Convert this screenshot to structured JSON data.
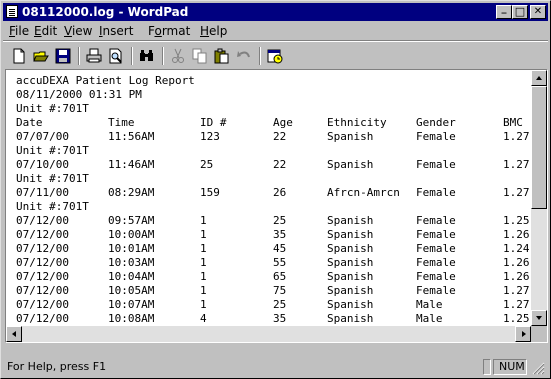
{
  "window": {
    "title": "08112000.log - WordPad",
    "minimize_glyph": "_",
    "maximize_glyph": "□",
    "close_glyph": "✕"
  },
  "menu": [
    {
      "accel": "F",
      "rest": "ile"
    },
    {
      "accel": "E",
      "rest": "dit"
    },
    {
      "accel": "V",
      "rest": "iew"
    },
    {
      "accel": "I",
      "rest": "nsert"
    },
    {
      "pre": "F",
      "accel": "o",
      "rest": "rmat"
    },
    {
      "accel": "H",
      "rest": "elp"
    }
  ],
  "toolbar": {
    "buttons": [
      "new-icon",
      "open-icon",
      "save-icon",
      "print-icon",
      "print-preview-icon",
      "find-icon",
      "cut-icon",
      "copy-icon",
      "paste-icon",
      "undo-icon",
      "date-time-icon"
    ],
    "disabled": [
      "cut-icon",
      "copy-icon",
      "undo-icon"
    ]
  },
  "document": {
    "header_lines": [
      "accuDEXA Patient Log Report",
      "08/11/2000 01:31 PM",
      "Unit #:701T"
    ],
    "columns": [
      "Date",
      "Time",
      "ID #",
      "Age",
      "Ethnicity",
      "Gender",
      "BMC"
    ],
    "rows": [
      {
        "type": "data",
        "cells": [
          "07/07/00",
          "11:56AM",
          "123",
          "22",
          "Spanish",
          "Female",
          "1.27"
        ]
      },
      {
        "type": "unit",
        "text": "Unit #:701T"
      },
      {
        "type": "data",
        "cells": [
          "07/10/00",
          "11:46AM",
          "25",
          "22",
          "Spanish",
          "Female",
          "1.27"
        ]
      },
      {
        "type": "unit",
        "text": "Unit #:701T"
      },
      {
        "type": "data",
        "cells": [
          "07/11/00",
          "08:29AM",
          "159",
          "26",
          "Afrcn-Amrcn",
          "Female",
          "1.27"
        ]
      },
      {
        "type": "unit",
        "text": "Unit #:701T"
      },
      {
        "type": "data",
        "cells": [
          "07/12/00",
          "09:57AM",
          "1",
          "25",
          "Spanish",
          "Female",
          "1.25"
        ]
      },
      {
        "type": "data",
        "cells": [
          "07/12/00",
          "10:00AM",
          "1",
          "35",
          "Spanish",
          "Female",
          "1.26"
        ]
      },
      {
        "type": "data",
        "cells": [
          "07/12/00",
          "10:01AM",
          "1",
          "45",
          "Spanish",
          "Female",
          "1.24"
        ]
      },
      {
        "type": "data",
        "cells": [
          "07/12/00",
          "10:03AM",
          "1",
          "55",
          "Spanish",
          "Female",
          "1.26"
        ]
      },
      {
        "type": "data",
        "cells": [
          "07/12/00",
          "10:04AM",
          "1",
          "65",
          "Spanish",
          "Female",
          "1.26"
        ]
      },
      {
        "type": "data",
        "cells": [
          "07/12/00",
          "10:05AM",
          "1",
          "75",
          "Spanish",
          "Female",
          "1.27"
        ]
      },
      {
        "type": "data",
        "cells": [
          "07/12/00",
          "10:07AM",
          "1",
          "25",
          "Spanish",
          "Male",
          "1.27"
        ]
      },
      {
        "type": "data",
        "cells": [
          "07/12/00",
          "10:08AM",
          "4",
          "35",
          "Spanish",
          "Male",
          "1.25"
        ]
      }
    ]
  },
  "status": {
    "help_text": "For Help, press F1",
    "num_indicator": "NUM"
  },
  "colors": {
    "title_bar": "#000080",
    "face": "#c0c0c0",
    "document_bg": "#ffffff"
  }
}
